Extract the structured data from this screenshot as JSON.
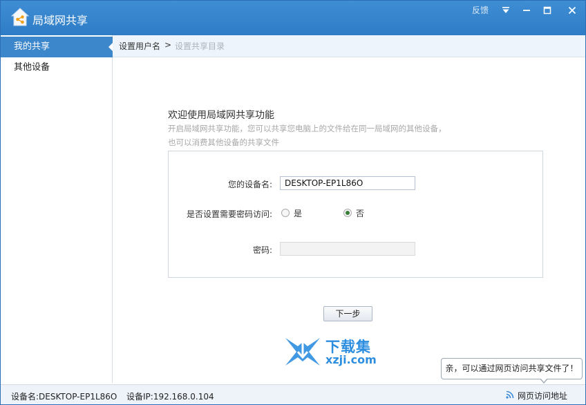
{
  "titlebar": {
    "title": "局域网共享",
    "feedback_label": "反馈",
    "menu_icon": "menu-down-icon",
    "minimize_icon": "minimize-icon",
    "maximize_icon": "maximize-icon",
    "close_icon": "close-icon"
  },
  "sidebar": {
    "items": [
      {
        "label": "我的共享",
        "active": true
      },
      {
        "label": "其他设备",
        "active": false
      }
    ]
  },
  "breadcrumb": {
    "step1": "设置用户名",
    "separator": ">",
    "step2": "设置共享目录"
  },
  "welcome": {
    "title": "欢迎使用局域网共享功能",
    "desc_line1": "开启局域网共享功能，您可以共享您电脑上的文件给在同一局域网的其他设备，",
    "desc_line2": "也可以消费其他设备的共享文件"
  },
  "form": {
    "device_name_label": "您的设备名:",
    "device_name_value": "DESKTOP-EP1L86O",
    "password_required_label": "是否设置需要密码访问:",
    "option_yes": "是",
    "option_no": "否",
    "selected_option": "否",
    "password_label": "密码:",
    "password_value": ""
  },
  "next_button": "下一步",
  "watermark": {
    "text_cn": "下载集",
    "text_en": "xzji.com"
  },
  "tooltip": "亲，可以通过网页访问共享文件了！",
  "statusbar": {
    "device_name": "设备名:DESKTOP-EP1L86O",
    "device_ip": "设备IP:192.168.0.104",
    "web_access_label": "网页访问地址"
  },
  "colors": {
    "titlebar": "#3585cc",
    "active_sidebar": "#3c86cc",
    "watermark": "#2d8ee0"
  }
}
